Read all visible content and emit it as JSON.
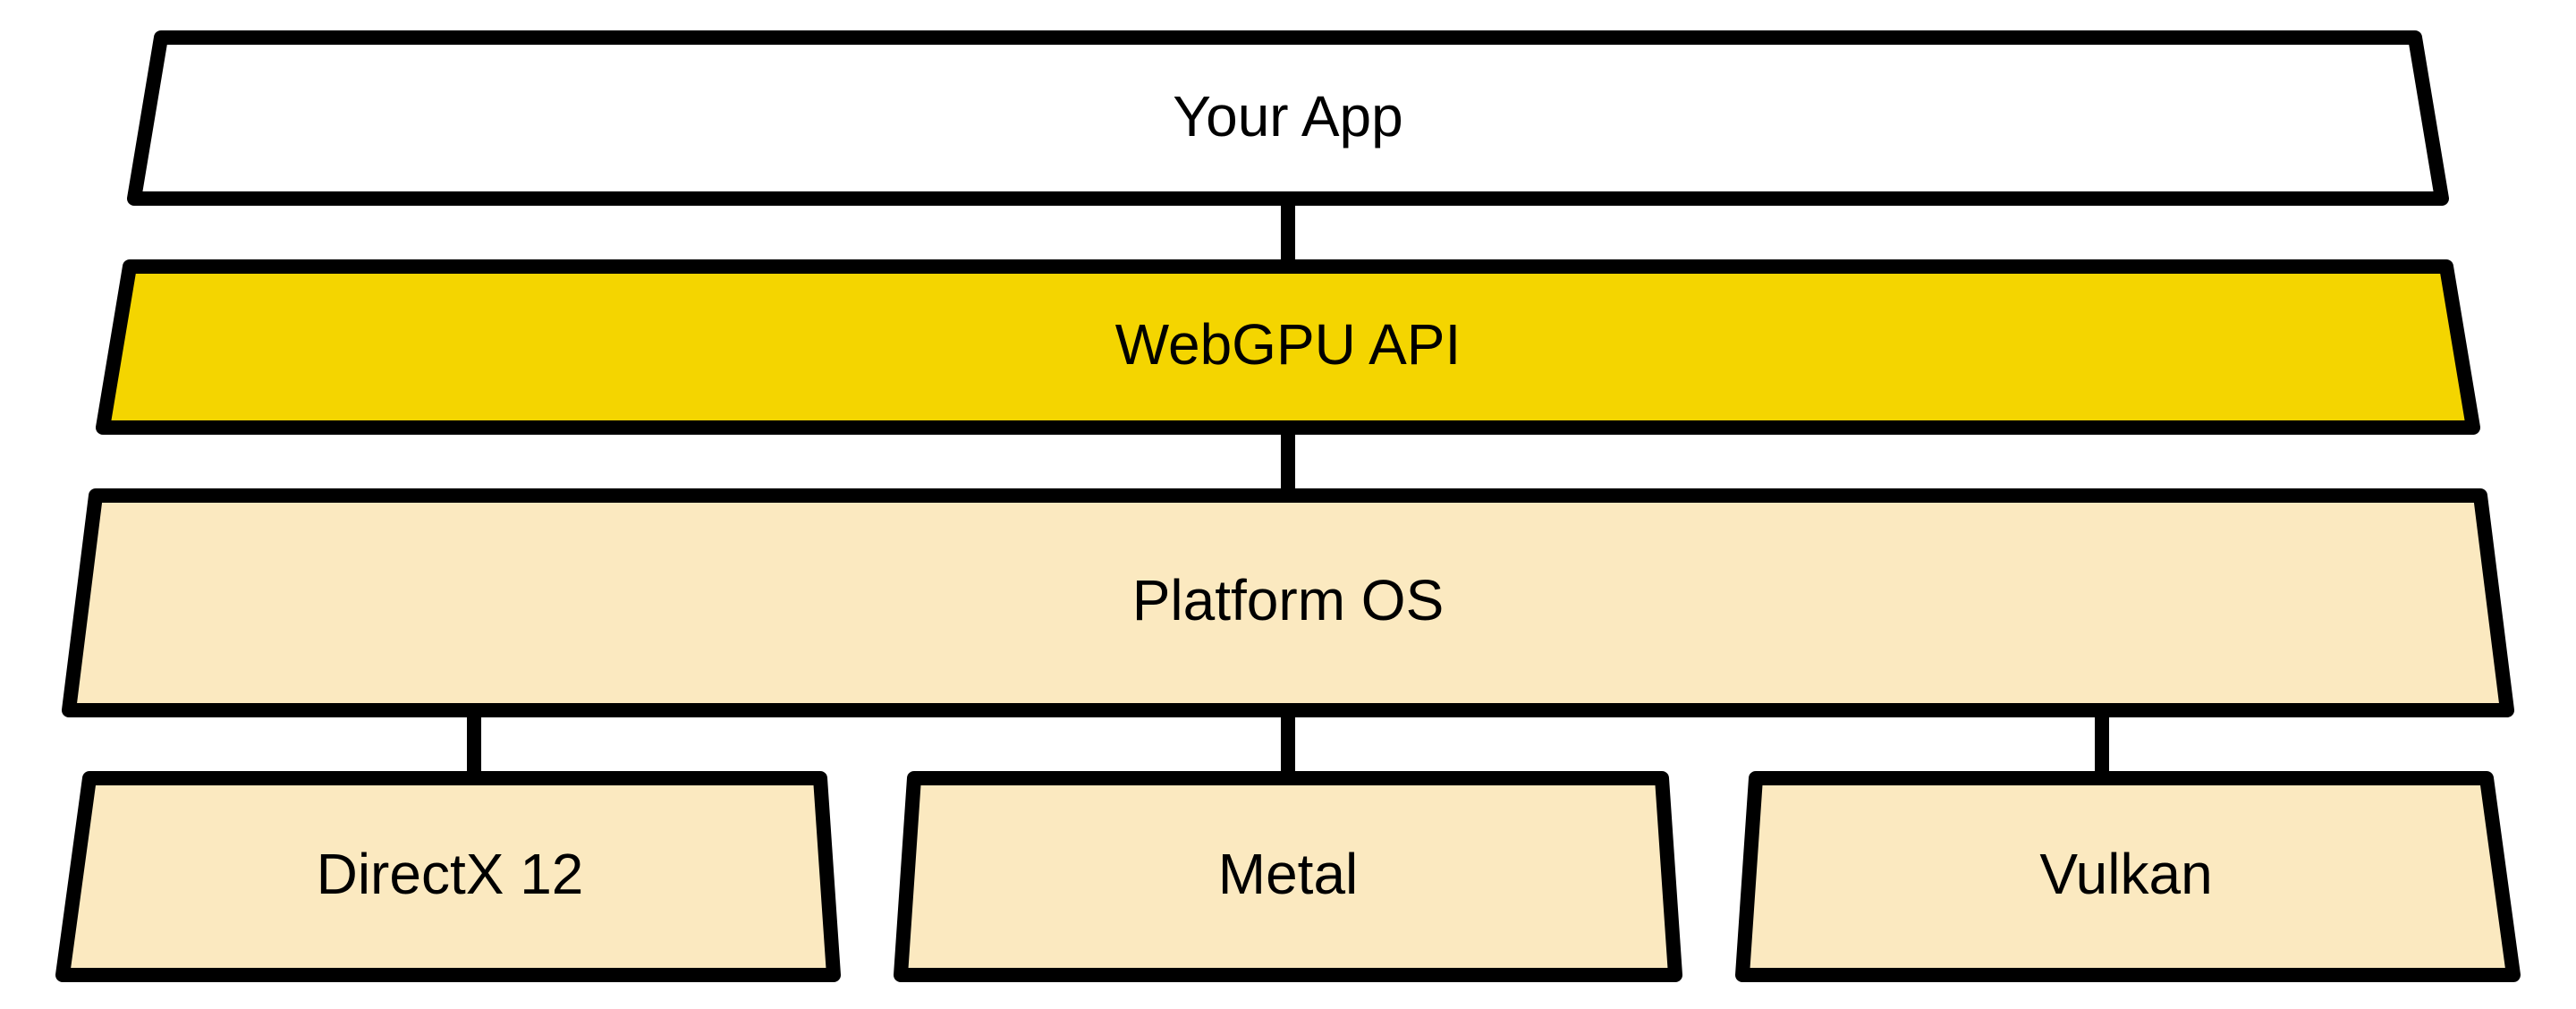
{
  "colors": {
    "stroke": "#000000",
    "white": "#FFFFFF",
    "yellow": "#F4D500",
    "cream": "#FBE9C0"
  },
  "layers": {
    "app": {
      "label": "Your App"
    },
    "webgpu": {
      "label": "WebGPU API"
    },
    "platform": {
      "label": "Platform OS"
    },
    "directx": {
      "label": "DirectX 12"
    },
    "metal": {
      "label": "Metal"
    },
    "vulkan": {
      "label": "Vulkan"
    }
  }
}
